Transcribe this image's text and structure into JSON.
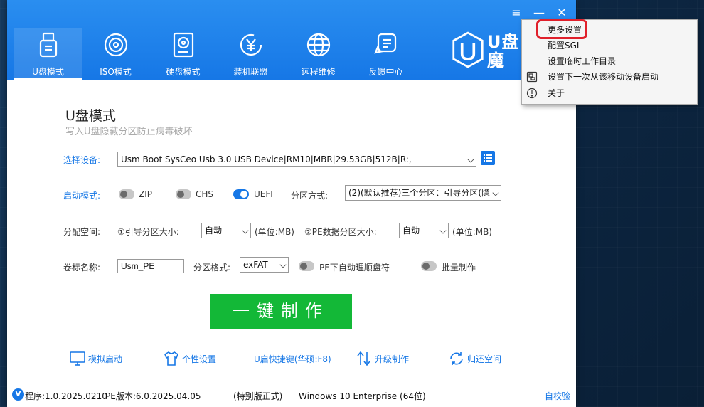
{
  "window": {
    "menu_glyph": "≡",
    "minimize_glyph": "—",
    "close_glyph": "✕"
  },
  "nav": [
    {
      "label": "U盘模式",
      "icon": "usb-drive-icon",
      "active": true
    },
    {
      "label": "ISO模式",
      "icon": "disc-icon",
      "active": false
    },
    {
      "label": "硬盘模式",
      "icon": "hard-disk-icon",
      "active": false
    },
    {
      "label": "装机联盟",
      "icon": "yuan-coin-icon",
      "active": false
    },
    {
      "label": "远程维修",
      "icon": "globe-icon",
      "active": false
    },
    {
      "label": "反馈中心",
      "icon": "feedback-chat-icon",
      "active": false
    }
  ],
  "brand": {
    "text": "U盘魔",
    "icon": "brand-logo-icon"
  },
  "page": {
    "title": "U盘模式",
    "subtitle": "写入U盘隐藏分区防止病毒破坏"
  },
  "device": {
    "label": "选择设备:",
    "value": "Usm Boot SysCeo Usb 3.0 USB Device|RM10|MBR|29.53GB|512B|R:,"
  },
  "boot": {
    "label": "启动模式:",
    "options": [
      {
        "label": "ZIP",
        "on": false
      },
      {
        "label": "CHS",
        "on": false
      },
      {
        "label": "UEFI",
        "on": true
      }
    ],
    "partition_label": "分区方式:",
    "partition_value": "(2)(默认推荐)三个分区：引导分区(隐"
  },
  "alloc": {
    "label": "分配空间:",
    "boot_label": "①引导分区大小:",
    "boot_value": "自动",
    "boot_unit": "(单位:MB)",
    "pe_label": "②PE数据分区大小:",
    "pe_value": "自动",
    "pe_unit": "(单位:MB)"
  },
  "volume": {
    "label": "卷标名称:",
    "value": "Usm_PE",
    "format_label": "分区格式:",
    "format_value": "exFAT",
    "auto_letter_label": "PE下自动理顺盘符",
    "auto_letter_on": false,
    "batch_label": "批量制作",
    "batch_on": false
  },
  "make_button": "一键制作",
  "tools": [
    {
      "label": "模拟启动",
      "icon": "monitor-icon"
    },
    {
      "label": "个性设置",
      "icon": "tshirt-icon"
    },
    {
      "label": "U启快捷键(华硕:F8)",
      "icon": ""
    },
    {
      "label": "升级制作",
      "icon": "upgrade-arrows-icon"
    },
    {
      "label": "归还空间",
      "icon": "restore-cycle-icon"
    }
  ],
  "status": {
    "badge": "V",
    "program": "程序:1.0.2025.0210",
    "pe_version": "PE版本:6.0.2025.04.05",
    "edition": "(特别版正式)",
    "os": "Windows 10 Enterprise (64位)",
    "check": "自校验"
  },
  "context_menu": {
    "items": [
      {
        "label": "更多设置",
        "icon": ""
      },
      {
        "label": "配置SGI",
        "icon": ""
      },
      {
        "label": "设置临时工作目录",
        "icon": ""
      },
      {
        "label": "设置下一次从该移动设备启动",
        "icon": "boot-device-icon"
      },
      {
        "label": "关于",
        "icon": "info-icon"
      }
    ]
  },
  "colors": {
    "header_blue": "#1677e6",
    "make_green": "#13b837",
    "highlight_red": "#e0202b"
  }
}
